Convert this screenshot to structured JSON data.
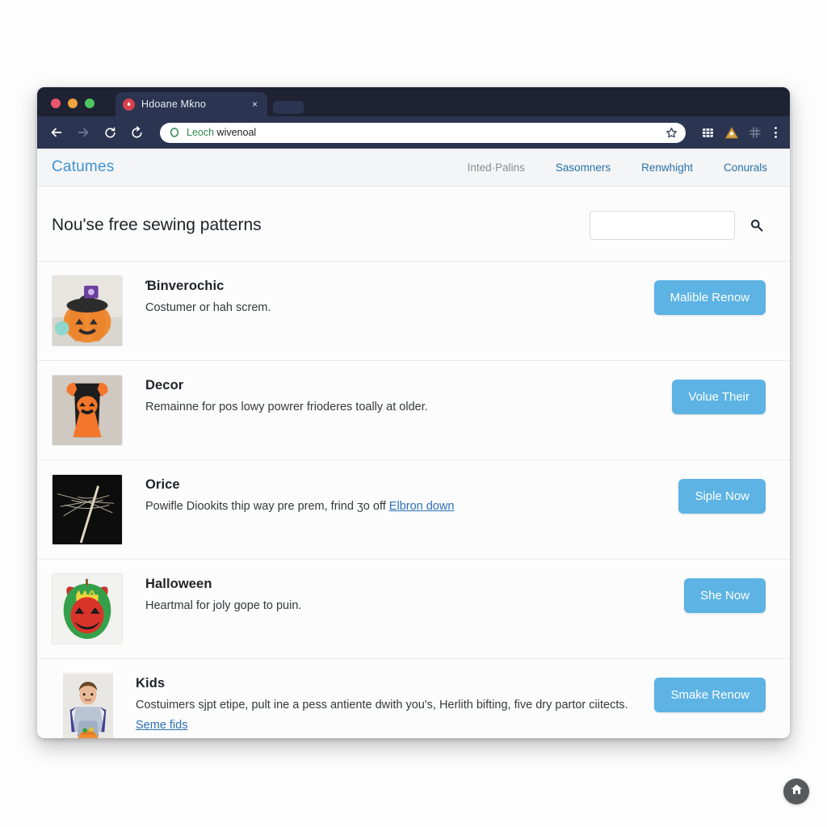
{
  "browser": {
    "tab": {
      "title": "Hdoane Mƙno",
      "favicon": "red-circle-favicon",
      "close_label": "×"
    },
    "toolbar": {
      "back_icon": "back-arrow-icon",
      "forward_icon": "forward-arrow-icon",
      "reload_icon": "reload-icon",
      "refresh_icon": "refresh-icon",
      "url_host": "Leoch",
      "url_rest": " wivenoal",
      "lock_icon": "green-shield-lock-icon",
      "star_icon": "bookmark-star-icon",
      "extension_icon": "grid-extension-icon",
      "warning_icon": "warning-triangle-icon",
      "puzzle_icon": "faded-puzzle-icon",
      "menu_icon": "kebab-menu-icon"
    }
  },
  "site": {
    "brand": "Catumes",
    "nav": [
      {
        "label": "Inted·Palins",
        "muted": true
      },
      {
        "label": "Sasomners",
        "muted": false
      },
      {
        "label": "Renwhight",
        "muted": false
      },
      {
        "label": "Conurals",
        "muted": false
      }
    ]
  },
  "page": {
    "title": "Nou'se free sewing patterns",
    "search": {
      "value": "",
      "placeholder": "",
      "icon": "search-icon"
    },
    "fab_icon": "home-icon"
  },
  "items": [
    {
      "title": "Ɓinverochic",
      "desc": "Costumer or hah screm.",
      "link": "",
      "cta": "Malible Renow",
      "thumb": "pumpkin-witch-hat-photo"
    },
    {
      "title": "Decor",
      "desc": "Remainne for pos lowy powrer frioderes toally at older.",
      "link": "",
      "cta": "Volue Their",
      "thumb": "orange-pumpkin-dress-photo"
    },
    {
      "title": "Orice",
      "desc": "Powifle Diookits thip way pre prem, frind ʒo off ",
      "link": "Elbron down",
      "cta": "Siple Now",
      "thumb": "spider-web-black-photo"
    },
    {
      "title": "Halloween",
      "desc": "Heartmal for joly gope to puin.",
      "link": "",
      "cta": "She Now",
      "thumb": "green-monster-pumpkin-photo"
    },
    {
      "title": "Kids",
      "desc": "Costuimers sjpt etipe, pult ine a pess antiente dwith you's, Herlith bifting, five dry partor ciitects.",
      "link": "Seme fids",
      "cta": "Smake Renow",
      "thumb": "boy-with-pumpkin-bucket-photo"
    }
  ],
  "colors": {
    "accent_blue": "#5cb3e4",
    "brand_blue": "#3d93d4",
    "link_blue": "#2a6fb5",
    "chrome_dark": "#2b3450"
  }
}
